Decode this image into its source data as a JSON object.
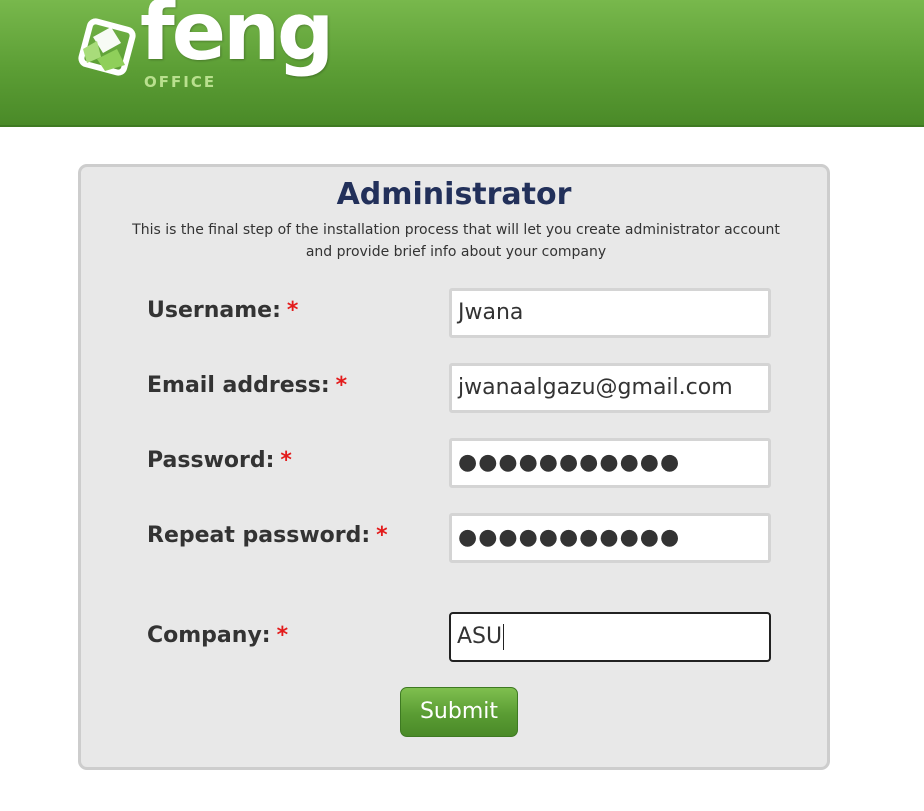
{
  "header": {
    "logo_word": "feng",
    "logo_sub": "OFFICE",
    "background_color": "#5c9e35"
  },
  "form": {
    "title": "Administrator",
    "description": "This is the final step of the installation process that will let you create administrator account and provide brief info about your company",
    "required_marker": "*",
    "fields": [
      {
        "label": "Username:",
        "value": "Jwana",
        "type": "text"
      },
      {
        "label": "Email address:",
        "value": "jwanaalgazu@gmail.com",
        "type": "text"
      },
      {
        "label": "Password:",
        "value": "●●●●●●●●●●●",
        "type": "password"
      },
      {
        "label": "Repeat password:",
        "value": "●●●●●●●●●●●",
        "type": "password"
      },
      {
        "label": "Company:",
        "value": "ASU",
        "type": "text",
        "focused": true
      }
    ],
    "submit_label": "Submit"
  }
}
